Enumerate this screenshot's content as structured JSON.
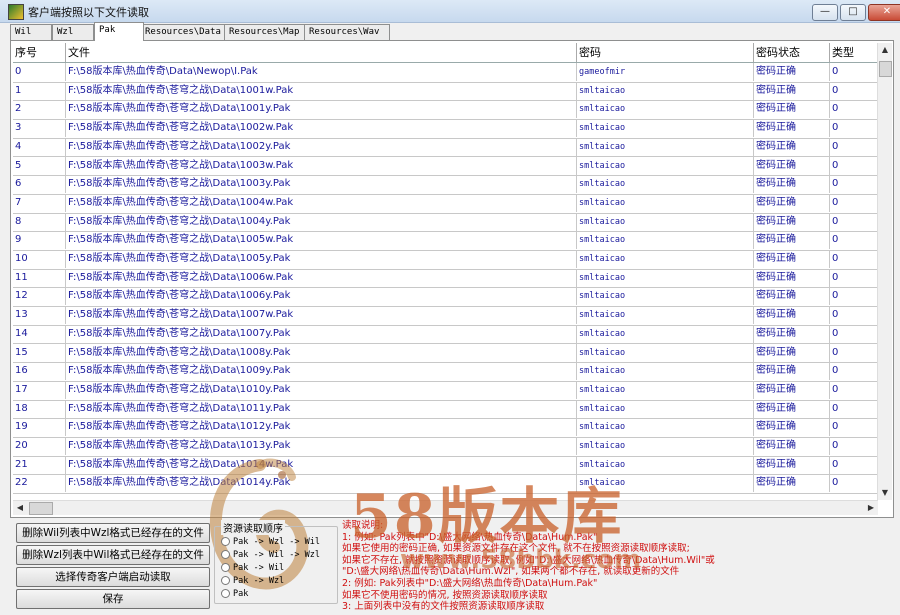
{
  "window": {
    "title": "客户端按照以下文件读取",
    "buttons": [
      "—",
      "□",
      "✕"
    ]
  },
  "tabs": [
    "Wil",
    "Wzl",
    "Pak",
    "Resources\\Data",
    "Resources\\Map",
    "Resources\\Wav"
  ],
  "active_tab": "Pak",
  "table": {
    "columns": [
      "序号",
      "文件",
      "密码",
      "密码状态",
      "类型"
    ],
    "rows": [
      [
        "0",
        "F:\\58版本库\\热血传奇\\Data\\Newop\\I.Pak",
        "gameofmir",
        "密码正确",
        "0"
      ],
      [
        "1",
        "F:\\58版本库\\热血传奇\\苍穹之战\\Data\\1001w.Pak",
        "smltaicao",
        "密码正确",
        "0"
      ],
      [
        "2",
        "F:\\58版本库\\热血传奇\\苍穹之战\\Data\\1001y.Pak",
        "smltaicao",
        "密码正确",
        "0"
      ],
      [
        "3",
        "F:\\58版本库\\热血传奇\\苍穹之战\\Data\\1002w.Pak",
        "smltaicao",
        "密码正确",
        "0"
      ],
      [
        "4",
        "F:\\58版本库\\热血传奇\\苍穹之战\\Data\\1002y.Pak",
        "smltaicao",
        "密码正确",
        "0"
      ],
      [
        "5",
        "F:\\58版本库\\热血传奇\\苍穹之战\\Data\\1003w.Pak",
        "smltaicao",
        "密码正确",
        "0"
      ],
      [
        "6",
        "F:\\58版本库\\热血传奇\\苍穹之战\\Data\\1003y.Pak",
        "smltaicao",
        "密码正确",
        "0"
      ],
      [
        "7",
        "F:\\58版本库\\热血传奇\\苍穹之战\\Data\\1004w.Pak",
        "smltaicao",
        "密码正确",
        "0"
      ],
      [
        "8",
        "F:\\58版本库\\热血传奇\\苍穹之战\\Data\\1004y.Pak",
        "smltaicao",
        "密码正确",
        "0"
      ],
      [
        "9",
        "F:\\58版本库\\热血传奇\\苍穹之战\\Data\\1005w.Pak",
        "smltaicao",
        "密码正确",
        "0"
      ],
      [
        "10",
        "F:\\58版本库\\热血传奇\\苍穹之战\\Data\\1005y.Pak",
        "smltaicao",
        "密码正确",
        "0"
      ],
      [
        "11",
        "F:\\58版本库\\热血传奇\\苍穹之战\\Data\\1006w.Pak",
        "smltaicao",
        "密码正确",
        "0"
      ],
      [
        "12",
        "F:\\58版本库\\热血传奇\\苍穹之战\\Data\\1006y.Pak",
        "smltaicao",
        "密码正确",
        "0"
      ],
      [
        "13",
        "F:\\58版本库\\热血传奇\\苍穹之战\\Data\\1007w.Pak",
        "smltaicao",
        "密码正确",
        "0"
      ],
      [
        "14",
        "F:\\58版本库\\热血传奇\\苍穹之战\\Data\\1007y.Pak",
        "smltaicao",
        "密码正确",
        "0"
      ],
      [
        "15",
        "F:\\58版本库\\热血传奇\\苍穹之战\\Data\\1008y.Pak",
        "smltaicao",
        "密码正确",
        "0"
      ],
      [
        "16",
        "F:\\58版本库\\热血传奇\\苍穹之战\\Data\\1009y.Pak",
        "smltaicao",
        "密码正确",
        "0"
      ],
      [
        "17",
        "F:\\58版本库\\热血传奇\\苍穹之战\\Data\\1010y.Pak",
        "smltaicao",
        "密码正确",
        "0"
      ],
      [
        "18",
        "F:\\58版本库\\热血传奇\\苍穹之战\\Data\\1011y.Pak",
        "smltaicao",
        "密码正确",
        "0"
      ],
      [
        "19",
        "F:\\58版本库\\热血传奇\\苍穹之战\\Data\\1012y.Pak",
        "smltaicao",
        "密码正确",
        "0"
      ],
      [
        "20",
        "F:\\58版本库\\热血传奇\\苍穹之战\\Data\\1013y.Pak",
        "smltaicao",
        "密码正确",
        "0"
      ],
      [
        "21",
        "F:\\58版本库\\热血传奇\\苍穹之战\\Data\\1014w.Pak",
        "smltaicao",
        "密码正确",
        "0"
      ],
      [
        "22",
        "F:\\58版本库\\热血传奇\\苍穹之战\\Data\\1014y.Pak",
        "smltaicao",
        "密码正确",
        "0"
      ]
    ]
  },
  "buttons": [
    "删除Wil列表中Wzl格式已经存在的文件",
    "删除Wzl列表中Wil格式已经存在的文件",
    "选择传奇客户端启动读取",
    "保存"
  ],
  "read_order": {
    "title": "资源读取顺序",
    "options": [
      "Pak -> Wzl -> Wil",
      "Pak -> Wil -> Wzl",
      "Pak -> Wil",
      "Pak -> Wzl",
      "Pak"
    ]
  },
  "notes": [
    "读取说明:",
    "1: 例如: Pak列表中\"D:\\盛大网络\\热血传奇\\Data\\Hum.Pak\"",
    "   如果它使用的密码正确, 如果资源文件存在这个文件, 就不在按照资源读取顺序读取;",
    "   如果它不存在, 就按照资源读取顺序读取, 例如\"D:\\盛大网络\\热血传奇\\Data\\Hum.Wil\"或",
    "   \"D:\\盛大网络\\热血传奇\\Data\\Hum.Wzl\", 如果两个都不存在, 就读取更新的文件",
    "2: 例如: Pak列表中\"D:\\盛大网络\\热血传奇\\Data\\Hum.Pak\"",
    "   如果它不使用密码的情况, 按照资源读取顺序读取",
    "3: 上面列表中没有的文件按照资源读取顺序读取"
  ],
  "watermark": {
    "text": "58版本库",
    "sub": "www.58bbk.com"
  }
}
